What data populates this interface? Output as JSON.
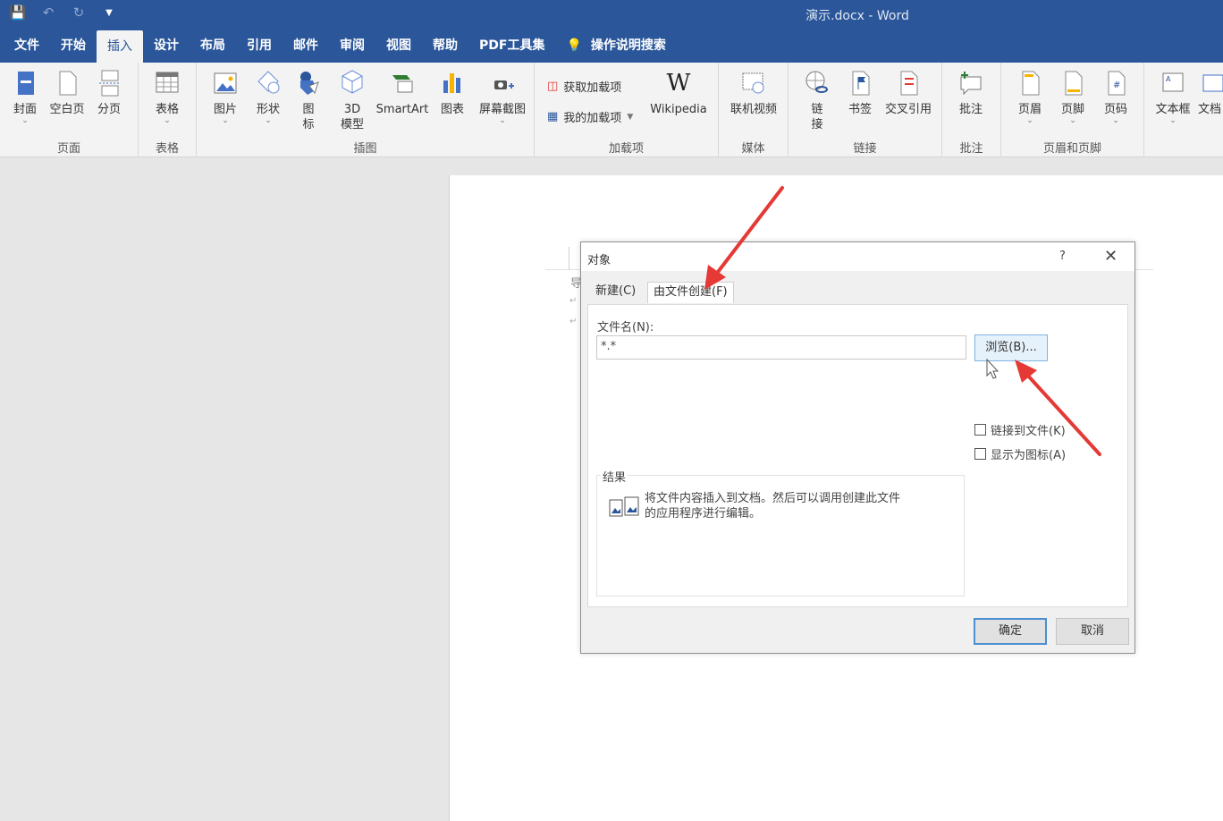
{
  "window": {
    "title": "演示.docx  -  Word",
    "quick_access": [
      "save-icon",
      "undo-icon",
      "redo-icon",
      "customize-icon"
    ]
  },
  "menu_tabs": [
    "文件",
    "开始",
    "插入",
    "设计",
    "布局",
    "引用",
    "邮件",
    "审阅",
    "视图",
    "帮助",
    "PDF工具集",
    "操作说明搜索"
  ],
  "ribbon": {
    "groups": {
      "pages": "页面",
      "tables": "表格",
      "illustrations": "插图",
      "addins": "加载项",
      "media": "媒体",
      "links": "链接",
      "comments": "批注",
      "header_footer": "页眉和页脚"
    },
    "buttons": {
      "cover": "封面",
      "blank_page": "空白页",
      "page_break": "分页",
      "table": "表格",
      "picture": "图片",
      "shapes": "形状",
      "icons_l1": "图",
      "icons_l2": "标",
      "model3d_l1": "3D",
      "model3d_l2": "模型",
      "smartart": "SmartArt",
      "chart": "图表",
      "screenshot": "屏幕截图",
      "get_addins": "获取加载项",
      "my_addins": "我的加载项",
      "wikipedia": "Wikipedia",
      "online_video": "联机视频",
      "link_l1": "链",
      "link_l2": "接",
      "bookmark": "书签",
      "cross_ref": "交叉引用",
      "comment": "批注",
      "header": "页眉",
      "footer": "页脚",
      "page_number": "页码",
      "textbox": "文本框",
      "doc_parts": "文档"
    }
  },
  "document": {
    "visible_char": "导"
  },
  "dialog": {
    "title": "对象",
    "help": "?",
    "close": "✕",
    "tabs": [
      "新建(C)",
      "由文件创建(F)"
    ],
    "file_name_label": "文件名(N):",
    "file_name_value": "*.*",
    "browse": "浏览(B)...",
    "link_to_file": "链接到文件(K)",
    "display_as_icon": "显示为图标(A)",
    "result_label": "结果",
    "result_text": "将文件内容插入到文档。然后可以调用创建此文件的应用程序进行编辑。",
    "ok": "确定",
    "cancel": "取消"
  },
  "colors": {
    "title_bar": "#2b579a",
    "ribbon_bg": "#f3f3f3",
    "annotation_arrow": "#e53935"
  }
}
